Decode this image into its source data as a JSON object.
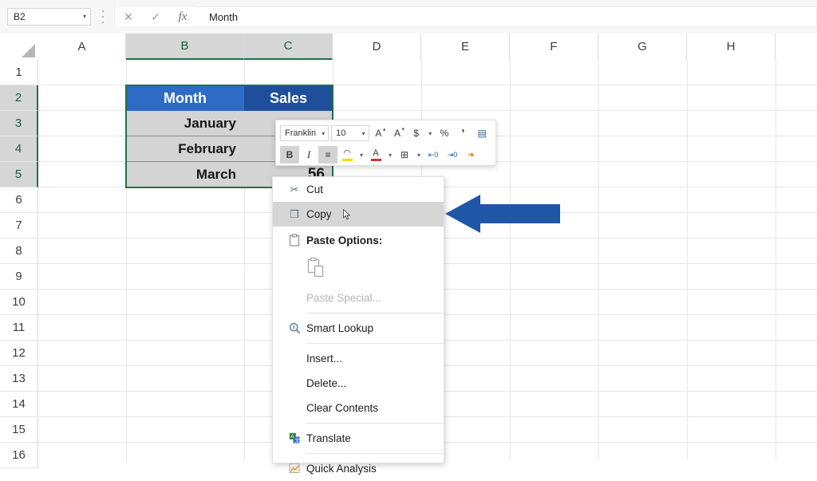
{
  "app": "Microsoft Excel",
  "formula_bar": {
    "name_box_value": "B2",
    "name_box_caret": "▾",
    "cancel_icon": "✕",
    "confirm_icon": "✓",
    "function_icon": "fx",
    "formula_value": "Month",
    "formula_placeholder": ""
  },
  "grid": {
    "columns": [
      "A",
      "B",
      "C",
      "D",
      "E",
      "F",
      "G",
      "H"
    ],
    "selected_columns": [
      "B",
      "C"
    ],
    "rows": [
      "1",
      "2",
      "3",
      "4",
      "5",
      "6",
      "7",
      "8",
      "9",
      "10",
      "11",
      "12",
      "13",
      "14",
      "15",
      "16"
    ],
    "selected_rows": [
      "2",
      "3",
      "4",
      "5"
    ],
    "selection_range": "B2:C5",
    "header_fill_active": "#2E6BC6",
    "header_fill": "#1F4E9C",
    "selection_fill": "#D4D4D4",
    "selection_border": "#217346",
    "cells": {
      "b2": "Month",
      "c2": "Sales",
      "b3": "January",
      "b4": "February",
      "b5": "March",
      "c5": "56"
    }
  },
  "mini_toolbar": {
    "font_name": "Franklin",
    "font_name_caret": "▾",
    "font_size": "10",
    "font_size_caret": "▾",
    "grow_font": "A",
    "grow_font_mark": "▴",
    "shrink_font": "A",
    "shrink_font_mark": "▾",
    "accounting_format": "$",
    "accounting_caret": "▾",
    "percent_format": "%",
    "comma_format": "❜",
    "format_table_icon": "▤",
    "bold": "B",
    "italic": "I",
    "align_icon": "≡",
    "fill_color_icon": "◠",
    "fill_color_caret": "▾",
    "fill_color_bar": "#FFD400",
    "font_color_icon": "A",
    "font_color_caret": "▾",
    "font_color_bar": "#D0342C",
    "borders_icon": "⊞",
    "borders_caret": "▾",
    "increase_decimal": "⇤0",
    "decrease_decimal": "⇥0",
    "format_painter_icon": "❧"
  },
  "context_menu": {
    "items": [
      {
        "id": "cut",
        "label": "Cut",
        "icon": "scissors-icon",
        "glyph": "✂",
        "state": "normal"
      },
      {
        "id": "copy",
        "label": "Copy",
        "icon": "copy-icon",
        "glyph": "❐",
        "state": "highlighted"
      },
      {
        "id": "paste-options",
        "label": "Paste Options:",
        "icon": "clipboard-icon",
        "glyph": "📋",
        "state": "header"
      },
      {
        "id": "paste-icon",
        "label": "",
        "icon": "paste-icon",
        "glyph": "❐",
        "state": "icon-row"
      },
      {
        "id": "paste-special",
        "label": "Paste Special...",
        "icon": "",
        "glyph": "",
        "state": "disabled"
      },
      {
        "id": "smart-lookup",
        "label": "Smart Lookup",
        "icon": "magnifier-icon",
        "glyph": "⌕",
        "state": "normal"
      },
      {
        "id": "insert",
        "label": "Insert...",
        "icon": "",
        "glyph": "",
        "state": "normal"
      },
      {
        "id": "delete",
        "label": "Delete...",
        "icon": "",
        "glyph": "",
        "state": "normal"
      },
      {
        "id": "clear-contents",
        "label": "Clear Contents",
        "icon": "",
        "glyph": "",
        "state": "normal"
      },
      {
        "id": "translate",
        "label": "Translate",
        "icon": "translate-icon",
        "glyph": "文",
        "state": "normal"
      },
      {
        "id": "quick-analysis",
        "label": "Quick Analysis",
        "icon": "quick-analysis-icon",
        "glyph": "▣",
        "state": "normal"
      }
    ],
    "highlighted_item": "Copy",
    "cursor_present": true
  },
  "annotation": {
    "type": "arrow",
    "direction": "left",
    "color": "#1F56A5",
    "points_to": "Copy"
  }
}
